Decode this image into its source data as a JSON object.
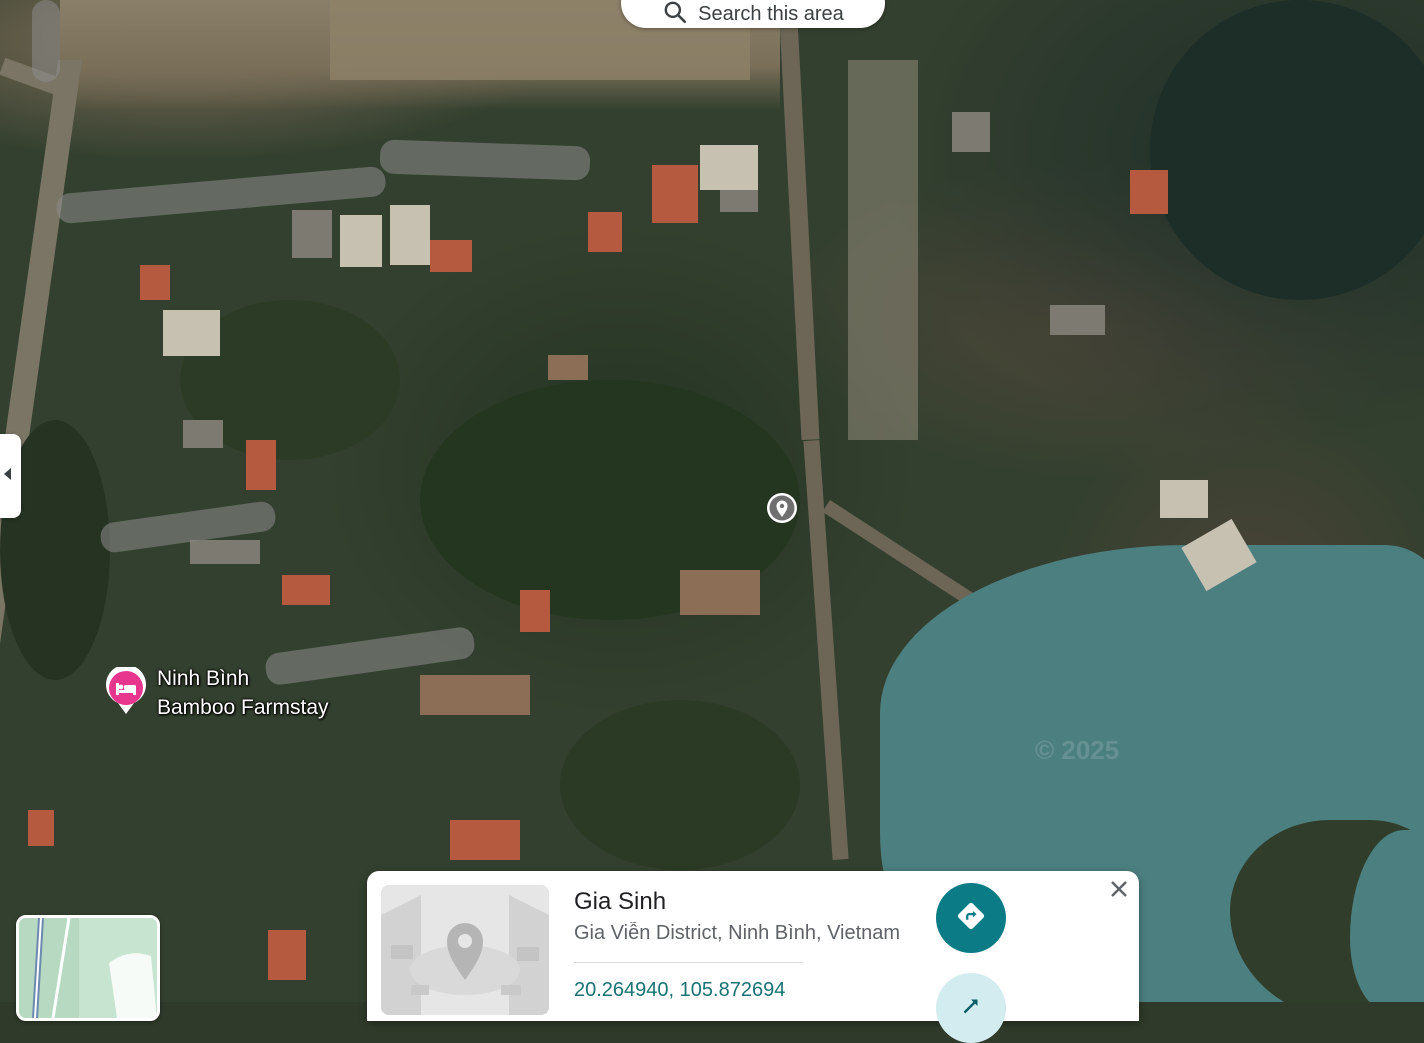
{
  "search_area": {
    "label": "Search this area"
  },
  "place_marker": {
    "name_line1": "Ninh Bình",
    "name_line2": "Bamboo Farmstay",
    "category_icon": "hotel-bed-icon",
    "color": "#e8368f"
  },
  "dropped_pin": {
    "icon": "location-pin-icon"
  },
  "info_card": {
    "title": "Gia Sinh",
    "address": "Gia Viễn District, Ninh Bình, Vietnam",
    "coordinates": "20.264940, 105.872694",
    "directions_icon": "directions-icon",
    "second_action_icon": "share-icon",
    "close_icon": "close-icon",
    "accent_color": "#0b7c86",
    "coords_color": "#1a7373"
  },
  "map": {
    "type": "satellite",
    "watermark": "© 2025"
  }
}
